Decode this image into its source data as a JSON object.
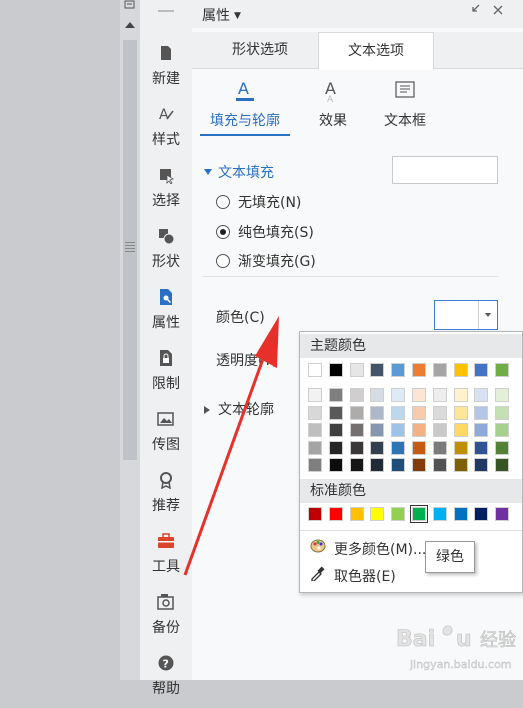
{
  "nav": {
    "items": [
      {
        "label": "新建",
        "icon": "new-file-icon"
      },
      {
        "label": "样式",
        "icon": "style-icon"
      },
      {
        "label": "选择",
        "icon": "select-icon"
      },
      {
        "label": "形状",
        "icon": "shape-icon"
      },
      {
        "label": "属性",
        "icon": "property-icon"
      },
      {
        "label": "限制",
        "icon": "restrict-icon"
      },
      {
        "label": "传图",
        "icon": "upload-image-icon"
      },
      {
        "label": "推荐",
        "icon": "recommend-icon"
      },
      {
        "label": "工具",
        "icon": "toolbox-icon"
      },
      {
        "label": "备份",
        "icon": "backup-icon"
      },
      {
        "label": "帮助",
        "icon": "help-icon"
      }
    ]
  },
  "panel": {
    "title": "属性",
    "tabs": [
      "形状选项",
      "文本选项"
    ],
    "active_tab": "文本选项",
    "subtabs": [
      "填充与轮廓",
      "效果",
      "文本框"
    ],
    "active_subtab": "填充与轮廓",
    "fill_section": {
      "title": "文本填充",
      "options": [
        "无填充(N)",
        "纯色填充(S)",
        "渐变填充(G)"
      ],
      "selected": "纯色填充(S)"
    },
    "color_label": "颜色(C)",
    "transparency_label": "透明度(T)",
    "outline_section": "文本轮廓"
  },
  "popup": {
    "theme_header": "主题颜色",
    "standard_header": "标准颜色",
    "theme_top_row": [
      "#ffffff",
      "#000000",
      "#e7e6e6",
      "#44546a",
      "#5b9bd5",
      "#ed7d31",
      "#a5a5a5",
      "#ffc000",
      "#4472c4",
      "#70ad47"
    ],
    "theme_shades": [
      [
        "#f2f2f2",
        "#7f7f7f",
        "#d0cece",
        "#d6dce4",
        "#deebf6",
        "#fbe5d5",
        "#ededed",
        "#fff2cc",
        "#d9e2f3",
        "#e2efd9"
      ],
      [
        "#d8d8d8",
        "#595959",
        "#aeabab",
        "#adb9ca",
        "#bdd7ee",
        "#f7cbac",
        "#dbdbdb",
        "#fee599",
        "#b4c6e7",
        "#c5e0b3"
      ],
      [
        "#bfbfbf",
        "#3f3f3f",
        "#757070",
        "#8496b0",
        "#9dc3e6",
        "#f4b183",
        "#c9c9c9",
        "#ffd965",
        "#8eaadb",
        "#a8d08d"
      ],
      [
        "#a5a5a5",
        "#262626",
        "#3a3838",
        "#323f4f",
        "#2e75b5",
        "#c55a11",
        "#7b7b7b",
        "#bf9000",
        "#2f5496",
        "#538135"
      ],
      [
        "#7f7f7f",
        "#0c0c0c",
        "#171616",
        "#222a35",
        "#1e4e79",
        "#833c0b",
        "#525252",
        "#7f6000",
        "#1f3864",
        "#375623"
      ]
    ],
    "standard_colors": [
      "#c00000",
      "#ff0000",
      "#ffc000",
      "#ffff00",
      "#92d050",
      "#00b050",
      "#00b0f0",
      "#0070c0",
      "#002060",
      "#7030a0"
    ],
    "selected_standard": "#00b050",
    "more_colors": "更多颜色(M)...",
    "eyedropper": "取色器(E)"
  },
  "tooltip": "绿色",
  "accent_color": "#2b6fc2",
  "annotation_color": "#e8302a"
}
